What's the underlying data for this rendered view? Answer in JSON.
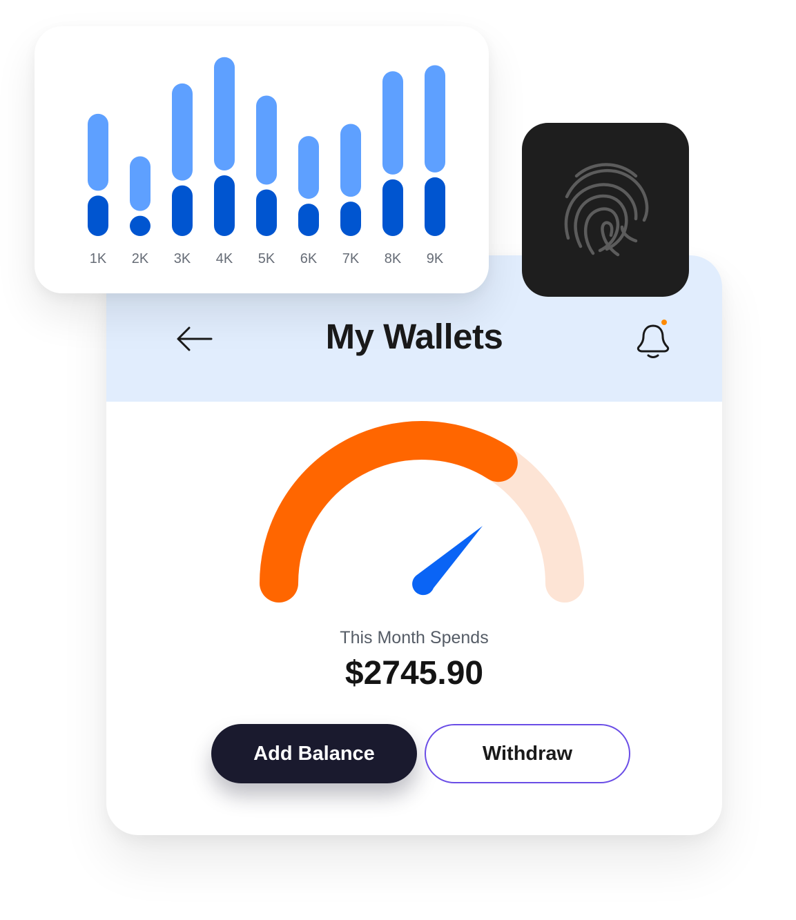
{
  "header": {
    "title": "My Wallets",
    "back_icon": "arrow-left-icon",
    "bell_icon": "bell-icon",
    "notification_dot_color": "#ff8a00"
  },
  "spends": {
    "label": "This Month Spends",
    "amount": "$2745.90",
    "gauge_fraction": 0.68,
    "gauge_color": "#ff6600",
    "gauge_track_color": "#fde4d5",
    "needle_color": "#0a64f5"
  },
  "actions": {
    "add_label": "Add Balance",
    "withdraw_label": "Withdraw"
  },
  "fingerprint": {
    "icon": "fingerprint-icon"
  },
  "chart_data": {
    "type": "bar",
    "stacked": true,
    "categories": [
      "1K",
      "2K",
      "3K",
      "4K",
      "5K",
      "6K",
      "7K",
      "8K",
      "9K"
    ],
    "series": [
      {
        "values": [
          2,
          1,
          2.5,
          3,
          2.3,
          1.6,
          1.7,
          2.8,
          2.9
        ],
        "color": "#0055d0"
      },
      {
        "values": [
          3.8,
          2.7,
          4.8,
          5.6,
          4.4,
          3.1,
          3.6,
          5.1,
          5.3
        ],
        "color": "#5ea0ff"
      }
    ],
    "ylim": [
      0,
      9
    ],
    "grid": false,
    "title": "",
    "xlabel": "",
    "ylabel": ""
  }
}
